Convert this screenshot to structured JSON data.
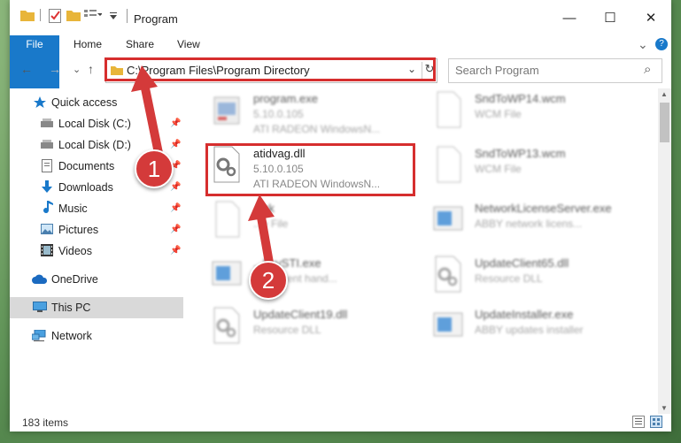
{
  "window": {
    "title": "Program",
    "controls": {
      "minimize": "—",
      "maximize": "☐",
      "close": "✕"
    }
  },
  "ribbon": {
    "tabs": [
      "File",
      "Home",
      "Share",
      "View"
    ],
    "expand": "⌄",
    "help": "?"
  },
  "address": {
    "path": "C:\\Program Files\\Program Directory",
    "back": "←",
    "forward": "→",
    "recent": "⌄",
    "up": "↑",
    "dropdown": "⌄",
    "refresh": "↻"
  },
  "search": {
    "placeholder": "Search Program",
    "icon": "⌕"
  },
  "sidebar": {
    "items": [
      {
        "label": "Quick access",
        "icon": "star-icon"
      },
      {
        "label": "Local Disk (C:)",
        "icon": "drive-icon"
      },
      {
        "label": "Local Disk (D:)",
        "icon": "drive-icon"
      },
      {
        "label": "Documents",
        "icon": "document-icon"
      },
      {
        "label": "Downloads",
        "icon": "download-icon"
      },
      {
        "label": "Music",
        "icon": "music-icon"
      },
      {
        "label": "Pictures",
        "icon": "pictures-icon"
      },
      {
        "label": "Videos",
        "icon": "video-icon"
      },
      {
        "label": "OneDrive",
        "icon": "cloud-icon"
      },
      {
        "label": "This PC",
        "icon": "pc-icon"
      },
      {
        "label": "Network",
        "icon": "network-icon"
      }
    ]
  },
  "files": [
    {
      "name": "program.exe",
      "sub1": "5.10.0.105",
      "sub2": "ATI RADEON WindowsN..."
    },
    {
      "name": "SndToWP14.wcm",
      "sub1": "WCM File",
      "sub2": ""
    },
    {
      "name": "atidvag.dll",
      "sub1": "5.10.0.105",
      "sub2": "ATI RADEON WindowsN..."
    },
    {
      "name": "SndToWP13.wcm",
      "sub1": "WCM File",
      "sub2": ""
    },
    {
      "name": "...ck",
      "sub1": "...e File",
      "sub2": ""
    },
    {
      "name": "NetworkLicenseServer.exe",
      "sub1": "ABBY network licens...",
      "sub2": ""
    },
    {
      "name": "...buySTI.exe",
      "sub1": "...sti event hand...",
      "sub2": ""
    },
    {
      "name": "UpdateClient65.dll",
      "sub1": "Resource DLL",
      "sub2": ""
    },
    {
      "name": "UpdateClient19.dll",
      "sub1": "Resource DLL",
      "sub2": ""
    },
    {
      "name": "UpdateInstaller.exe",
      "sub1": "ABBY updates installer",
      "sub2": ""
    }
  ],
  "status": {
    "count": "183 items"
  },
  "annotations": {
    "step1": "1",
    "step2": "2"
  },
  "colors": {
    "accent": "#1979ca",
    "highlight": "#d62e2e"
  }
}
